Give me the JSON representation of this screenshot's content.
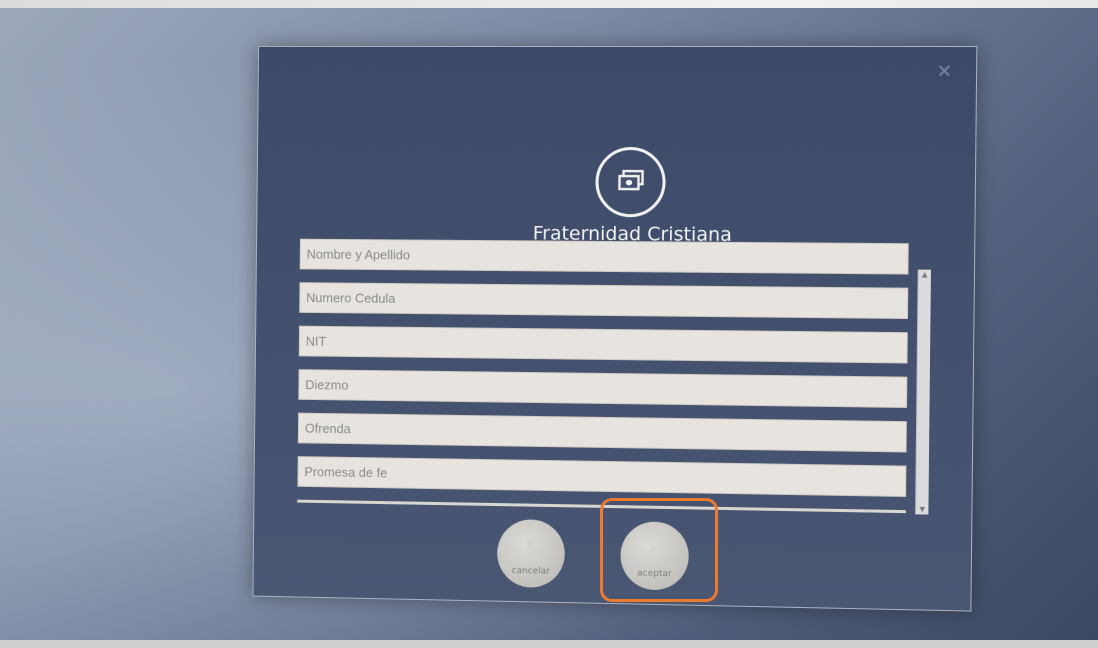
{
  "dialog": {
    "title": "Fraternidad Cristiana",
    "close_icon": "close-icon",
    "logo_icon": "money-stack-icon"
  },
  "form": {
    "fields": [
      {
        "placeholder": "Nombre y Apellido",
        "value": ""
      },
      {
        "placeholder": "Numero Cedula",
        "value": ""
      },
      {
        "placeholder": "NIT",
        "value": ""
      },
      {
        "placeholder": "Diezmo",
        "value": ""
      },
      {
        "placeholder": "Ofrenda",
        "value": ""
      },
      {
        "placeholder": "Promesa de fe",
        "value": ""
      }
    ]
  },
  "actions": {
    "cancel_label": "cancelar",
    "accept_label": "aceptar"
  },
  "colors": {
    "dialog_bg": "#3c4a68",
    "field_bg": "#e7e4df",
    "highlight": "#ee7a2e"
  }
}
